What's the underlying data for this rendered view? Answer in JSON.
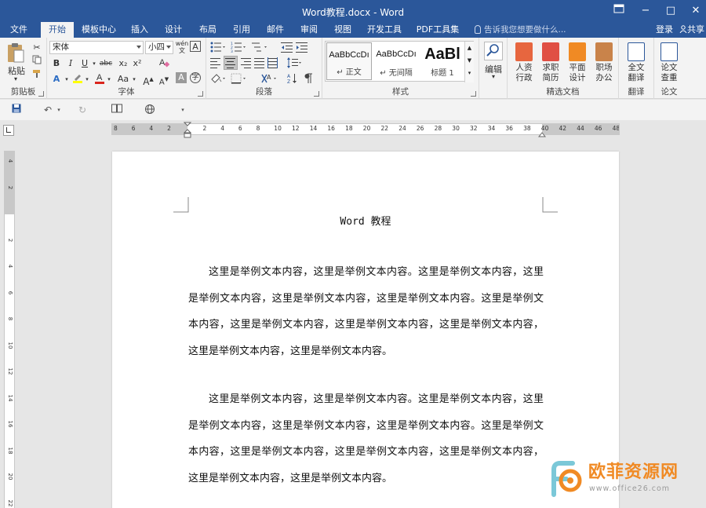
{
  "window": {
    "title": "Word教程.docx - Word",
    "restore_icon": "ribbon-display-icon",
    "minimize": "−",
    "maximize": "□",
    "close": "✕"
  },
  "tabs": [
    "文件",
    "开始",
    "模板中心",
    "插入",
    "设计",
    "布局",
    "引用",
    "邮件",
    "审阅",
    "视图",
    "开发工具",
    "PDF工具集"
  ],
  "active_tab": "开始",
  "tell_me": "告诉我您想要做什么...",
  "account": {
    "login": "登录",
    "share": "共享"
  },
  "ribbon": {
    "clipboard": {
      "paste": "粘贴",
      "label": "剪贴板"
    },
    "font": {
      "font_name": "宋体",
      "font_size": "小四",
      "wen": "wén",
      "wen_char": "文",
      "a_box": "A",
      "bold": "B",
      "italic": "I",
      "underline": "U",
      "strike": "abc",
      "subscript": "x₂",
      "superscript": "x²",
      "grow": "A",
      "shrink": "A",
      "case": "Aa",
      "clear": "A",
      "char_shade": "A",
      "char_border": "字",
      "font_color_hex": "#d9251d",
      "highlight_hex": "#ffff00",
      "label": "字体"
    },
    "paragraph": {
      "label": "段落"
    },
    "styles": {
      "items": [
        {
          "preview": "AaBbCcDı",
          "name": "↵ 正文"
        },
        {
          "preview": "AaBbCcDı",
          "name": "↵ 无间隔"
        },
        {
          "preview": "AaBl",
          "name": "标题 1"
        }
      ],
      "label": "样式"
    },
    "editing": {
      "label": "编辑"
    },
    "featured": {
      "items": [
        {
          "l1": "人资",
          "l2": "行政"
        },
        {
          "l1": "求职",
          "l2": "简历"
        },
        {
          "l1": "平面",
          "l2": "设计"
        },
        {
          "l1": "职场",
          "l2": "办公"
        }
      ],
      "label": "精选文档"
    },
    "translate": {
      "l1": "全文",
      "l2": "翻译",
      "label": "翻译"
    },
    "paper": {
      "l1": "论文",
      "l2": "查重",
      "label": "论文"
    }
  },
  "ruler": {
    "ticks": [
      "8",
      "6",
      "4",
      "2",
      "",
      "2",
      "4",
      "6",
      "8",
      "10",
      "12",
      "14",
      "16",
      "18",
      "20",
      "22",
      "24",
      "26",
      "28",
      "30",
      "32",
      "34",
      "36",
      "38",
      "40",
      "42",
      "44",
      "46",
      "48"
    ],
    "vticks": [
      "4",
      "2",
      "",
      "2",
      "4",
      "6",
      "8",
      "10",
      "12",
      "14",
      "16",
      "18",
      "20",
      "22"
    ]
  },
  "document": {
    "title": "Word 教程",
    "paragraphs": [
      "这里是举例文本内容，这里是举例文本内容。这里是举例文本内容，这里是举例文本内容，这里是举例文本内容，这里是举例文本内容。这里是举例文本内容，这里是举例文本内容，这里是举例文本内容，这里是举例文本内容，这里是举例文本内容，这里是举例文本内容。",
      "这里是举例文本内容，这里是举例文本内容。这里是举例文本内容，这里是举例文本内容，这里是举例文本内容，这里是举例文本内容。这里是举例文本内容，这里是举例文本内容，这里是举例文本内容，这里是举例文本内容，这里是举例文本内容，这里是举例文本内容。"
    ]
  },
  "watermark": {
    "name": "欧菲资源网",
    "url": "www.office26.com"
  }
}
